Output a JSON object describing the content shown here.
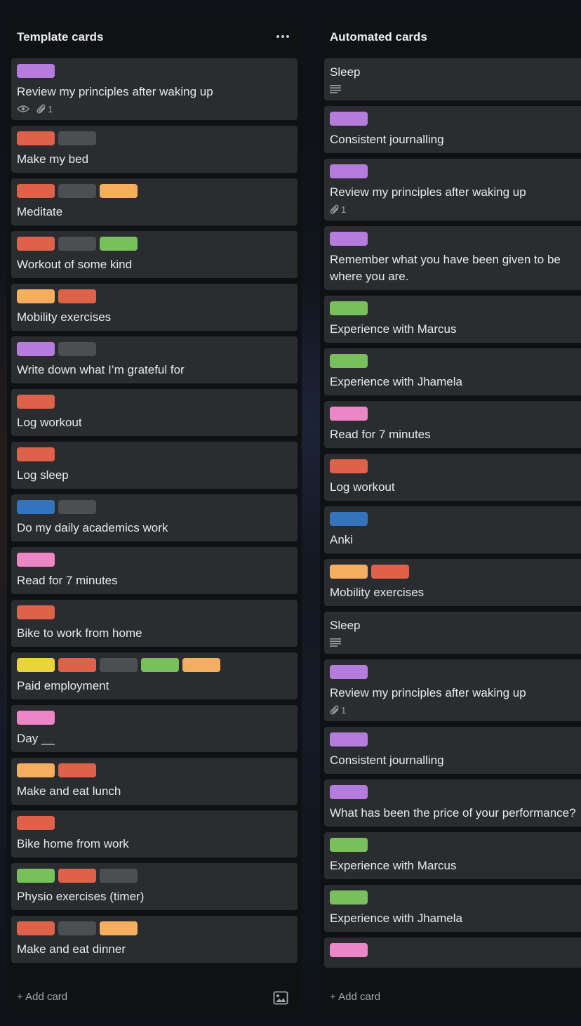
{
  "colors": {
    "purple": "#b57cde",
    "red": "#de6149",
    "gray": "#4d4e51",
    "orange": "#f4ae5d",
    "green": "#78c05a",
    "blue": "#3474bd",
    "pink": "#ec86c6",
    "yellow": "#e9d43a"
  },
  "lists": [
    {
      "title": "Template cards",
      "menu_icon": "more-horizontal-icon",
      "add_card_label": "+ Add card",
      "template_icon": "card-template-icon",
      "cards": [
        {
          "labels": [
            "purple"
          ],
          "title": "Review my principles after waking up",
          "watch": true,
          "attachments": "1"
        },
        {
          "labels": [
            "red",
            "gray"
          ],
          "title": "Make my bed"
        },
        {
          "labels": [
            "red",
            "gray",
            "orange"
          ],
          "title": "Meditate"
        },
        {
          "labels": [
            "red",
            "gray",
            "green"
          ],
          "title": "Workout of some kind"
        },
        {
          "labels": [
            "orange",
            "red"
          ],
          "title": "Mobility exercises"
        },
        {
          "labels": [
            "purple",
            "gray"
          ],
          "title": "Write down what I’m grateful for"
        },
        {
          "labels": [
            "red"
          ],
          "title": "Log workout"
        },
        {
          "labels": [
            "red"
          ],
          "title": "Log sleep"
        },
        {
          "labels": [
            "blue",
            "gray"
          ],
          "title": "Do my daily academics work"
        },
        {
          "labels": [
            "pink"
          ],
          "title": "Read for 7 minutes"
        },
        {
          "labels": [
            "red"
          ],
          "title": "Bike to work from home"
        },
        {
          "labels": [
            "yellow",
            "red",
            "gray",
            "green",
            "orange"
          ],
          "title": "Paid employment"
        },
        {
          "labels": [
            "pink"
          ],
          "title": "Day __"
        },
        {
          "labels": [
            "orange",
            "red"
          ],
          "title": "Make and eat lunch"
        },
        {
          "labels": [
            "red"
          ],
          "title": "Bike home from work"
        },
        {
          "labels": [
            "green",
            "red",
            "gray"
          ],
          "title": "Physio exercises (timer)"
        },
        {
          "labels": [
            "red",
            "gray",
            "orange"
          ],
          "title": "Make and eat dinner"
        }
      ]
    },
    {
      "title": "Automated cards",
      "add_card_label": "+ Add card",
      "cards": [
        {
          "labels": [],
          "title": "Sleep",
          "description": true
        },
        {
          "labels": [
            "purple"
          ],
          "title": "Consistent journalling"
        },
        {
          "labels": [
            "purple"
          ],
          "title": "Review my principles after waking up",
          "attachments": "1"
        },
        {
          "labels": [
            "purple"
          ],
          "title": "Remember what you have been given to be where you are.",
          "wrap": true
        },
        {
          "labels": [
            "green"
          ],
          "title": "Experience with Marcus"
        },
        {
          "labels": [
            "green"
          ],
          "title": "Experience with Jhamela"
        },
        {
          "labels": [
            "pink"
          ],
          "title": "Read for 7 minutes"
        },
        {
          "labels": [
            "red"
          ],
          "title": "Log workout"
        },
        {
          "labels": [
            "blue"
          ],
          "title": "Anki"
        },
        {
          "labels": [
            "orange",
            "red"
          ],
          "title": "Mobility exercises"
        },
        {
          "labels": [],
          "title": "Sleep",
          "description": true
        },
        {
          "labels": [
            "purple"
          ],
          "title": "Review my principles after waking up",
          "attachments": "1"
        },
        {
          "labels": [
            "purple"
          ],
          "title": "Consistent journalling"
        },
        {
          "labels": [
            "purple"
          ],
          "title": "What has been the price of your performance?"
        },
        {
          "labels": [
            "green"
          ],
          "title": "Experience with Marcus"
        },
        {
          "labels": [
            "green"
          ],
          "title": "Experience with Jhamela"
        },
        {
          "labels": [
            "pink"
          ],
          "title": ""
        }
      ]
    }
  ]
}
